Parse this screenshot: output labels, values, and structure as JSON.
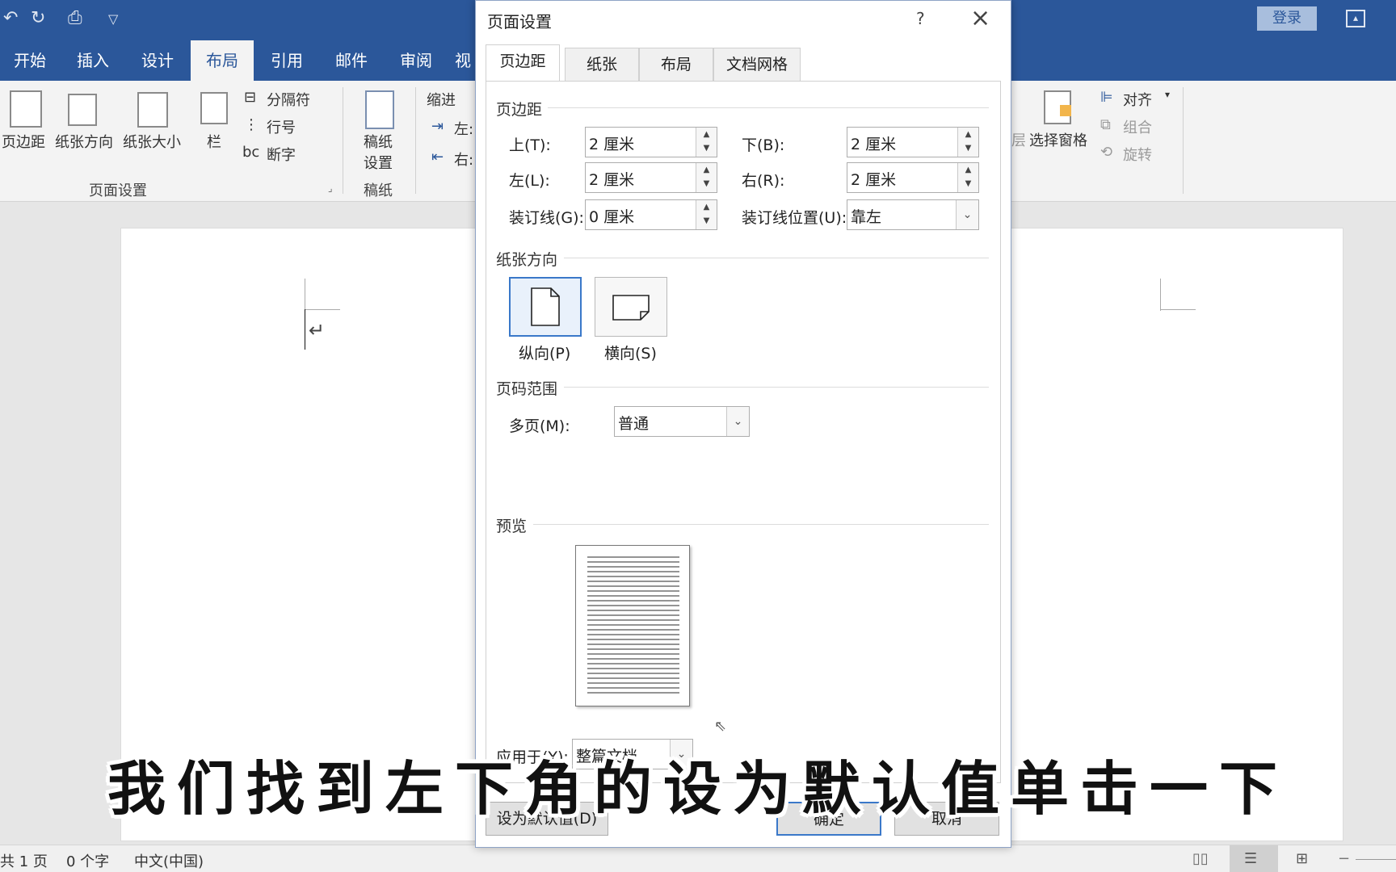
{
  "titlebar": {
    "login_label": "登录",
    "qat_icons": [
      "undo-icon",
      "redo-icon",
      "quick-print-icon",
      "customize-qat-icon"
    ]
  },
  "tabs": [
    "开始",
    "插入",
    "设计",
    "布局",
    "引用",
    "邮件",
    "审阅",
    "视"
  ],
  "active_tab": "布局",
  "ribbon": {
    "margins": "页边距",
    "orientation": "纸张方向",
    "size": "纸张大小",
    "columns": "栏",
    "breaks": "分隔符",
    "line_numbers": "行号",
    "hyphenation": "断字",
    "page_setup_group": "页面设置",
    "manuscript_btn_line1": "稿纸",
    "manuscript_btn_line2": "设置",
    "manuscript_group": "稿纸",
    "indent": "缩进",
    "indent_left": "左:",
    "indent_right": "右:",
    "layer_partial": "层",
    "selection_pane": "选择窗格",
    "align": "对齐",
    "group": "组合",
    "rotate": "旋转"
  },
  "status": {
    "pages": "共 1 页",
    "words": "0 个字",
    "language": "中文(中国)"
  },
  "dialog": {
    "title": "页面设置",
    "help": "?",
    "tabs": [
      "页边距",
      "纸张",
      "布局",
      "文档网格"
    ],
    "margins_section": "页边距",
    "top_label": "上(T):",
    "top_value": "2 厘米",
    "bottom_label": "下(B):",
    "bottom_value": "2 厘米",
    "left_label": "左(L):",
    "left_value": "2 厘米",
    "right_label": "右(R):",
    "right_value": "2 厘米",
    "gutter_label": "装订线(G):",
    "gutter_value": "0 厘米",
    "gutter_pos_label": "装订线位置(U):",
    "gutter_pos_value": "靠左",
    "orientation_section": "纸张方向",
    "portrait": "纵向(P)",
    "landscape": "横向(S)",
    "pages_section": "页码范围",
    "multiple_label": "多页(M):",
    "multiple_value": "普通",
    "preview_section": "预览",
    "apply_label": "应用于(Y):",
    "apply_value": "整篇文档",
    "default_btn": "设为默认值(D)",
    "ok_btn": "确定",
    "cancel_btn": "取消"
  },
  "subtitle": "我们找到左下角的设为默认值单击一下"
}
